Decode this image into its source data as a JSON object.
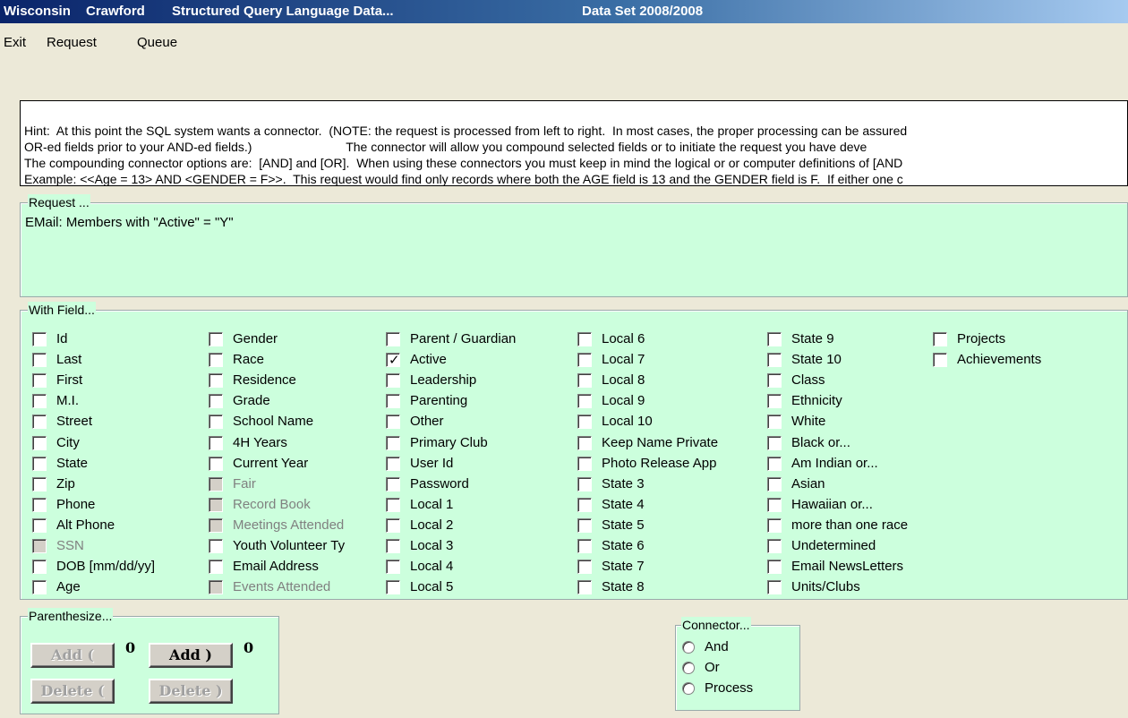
{
  "titlebar": {
    "app": "Wisconsin",
    "county": "Crawford",
    "title": "Structured Query Language Data...",
    "dataset": "Data Set 2008/2008"
  },
  "menu": {
    "exit": "Exit",
    "request": "Request",
    "queue": "Queue"
  },
  "hint": {
    "lines": [
      "Hint:  At this point the SQL system wants a connector.  (NOTE: the request is processed from left to right.  In most cases, the proper processing can be assured",
      "OR-ed fields prior to your AND-ed fields.)                           The connector will allow you compound selected fields or to initiate the request you have deve",
      "The compounding connector options are:  [AND] and [OR].  When using these connectors you must keep in mind the logical or or computer definitions of [AND",
      "Example: <<Age = 13> AND <GENDER = F>>.  This request would find only records where both the AGE field is 13 and the GENDER field is F.  If either one c"
    ]
  },
  "request": {
    "legend": "Request ...",
    "text": "EMail: Members with \"Active\" = \"Y\""
  },
  "fields": {
    "legend": "With Field...",
    "columns": [
      [
        {
          "label": "Id",
          "checked": false,
          "disabled": false
        },
        {
          "label": "Last",
          "checked": false,
          "disabled": false
        },
        {
          "label": "First",
          "checked": false,
          "disabled": false
        },
        {
          "label": "M.I.",
          "checked": false,
          "disabled": false
        },
        {
          "label": "Street",
          "checked": false,
          "disabled": false
        },
        {
          "label": "City",
          "checked": false,
          "disabled": false
        },
        {
          "label": "State",
          "checked": false,
          "disabled": false
        },
        {
          "label": "Zip",
          "checked": false,
          "disabled": false
        },
        {
          "label": "Phone",
          "checked": false,
          "disabled": false
        },
        {
          "label": "Alt Phone",
          "checked": false,
          "disabled": false
        },
        {
          "label": "SSN",
          "checked": false,
          "disabled": true
        },
        {
          "label": "DOB [mm/dd/yy]",
          "checked": false,
          "disabled": false
        },
        {
          "label": "Age",
          "checked": false,
          "disabled": false
        }
      ],
      [
        {
          "label": "Gender",
          "checked": false,
          "disabled": false
        },
        {
          "label": "Race",
          "checked": false,
          "disabled": false
        },
        {
          "label": "Residence",
          "checked": false,
          "disabled": false
        },
        {
          "label": "Grade",
          "checked": false,
          "disabled": false
        },
        {
          "label": "School Name",
          "checked": false,
          "disabled": false
        },
        {
          "label": "4H Years",
          "checked": false,
          "disabled": false
        },
        {
          "label": "Current Year",
          "checked": false,
          "disabled": false
        },
        {
          "label": "Fair",
          "checked": false,
          "disabled": true
        },
        {
          "label": "Record Book",
          "checked": false,
          "disabled": true
        },
        {
          "label": "Meetings Attended",
          "checked": false,
          "disabled": true
        },
        {
          "label": "Youth Volunteer Ty",
          "checked": false,
          "disabled": false
        },
        {
          "label": "Email Address",
          "checked": false,
          "disabled": false
        },
        {
          "label": "Events Attended",
          "checked": false,
          "disabled": true
        }
      ],
      [
        {
          "label": "Parent / Guardian",
          "checked": false,
          "disabled": false
        },
        {
          "label": "Active",
          "checked": true,
          "disabled": false
        },
        {
          "label": "Leadership",
          "checked": false,
          "disabled": false
        },
        {
          "label": "Parenting",
          "checked": false,
          "disabled": false
        },
        {
          "label": "Other",
          "checked": false,
          "disabled": false
        },
        {
          "label": "Primary Club",
          "checked": false,
          "disabled": false
        },
        {
          "label": "User Id",
          "checked": false,
          "disabled": false
        },
        {
          "label": "Password",
          "checked": false,
          "disabled": false
        },
        {
          "label": "Local 1",
          "checked": false,
          "disabled": false
        },
        {
          "label": "Local 2",
          "checked": false,
          "disabled": false
        },
        {
          "label": "Local 3",
          "checked": false,
          "disabled": false
        },
        {
          "label": "Local 4",
          "checked": false,
          "disabled": false
        },
        {
          "label": "Local 5",
          "checked": false,
          "disabled": false
        }
      ],
      [
        {
          "label": "Local 6",
          "checked": false,
          "disabled": false
        },
        {
          "label": "Local 7",
          "checked": false,
          "disabled": false
        },
        {
          "label": "Local 8",
          "checked": false,
          "disabled": false
        },
        {
          "label": "Local 9",
          "checked": false,
          "disabled": false
        },
        {
          "label": "Local 10",
          "checked": false,
          "disabled": false
        },
        {
          "label": "Keep Name Private",
          "checked": false,
          "disabled": false
        },
        {
          "label": "Photo Release App",
          "checked": false,
          "disabled": false
        },
        {
          "label": "State 3",
          "checked": false,
          "disabled": false
        },
        {
          "label": "State 4",
          "checked": false,
          "disabled": false
        },
        {
          "label": "State 5",
          "checked": false,
          "disabled": false
        },
        {
          "label": "State 6",
          "checked": false,
          "disabled": false
        },
        {
          "label": "State 7",
          "checked": false,
          "disabled": false
        },
        {
          "label": "State 8",
          "checked": false,
          "disabled": false
        }
      ],
      [
        {
          "label": "State 9",
          "checked": false,
          "disabled": false
        },
        {
          "label": "State 10",
          "checked": false,
          "disabled": false
        },
        {
          "label": "Class",
          "checked": false,
          "disabled": false
        },
        {
          "label": "Ethnicity",
          "checked": false,
          "disabled": false
        },
        {
          "label": "White",
          "checked": false,
          "disabled": false
        },
        {
          "label": "Black or...",
          "checked": false,
          "disabled": false
        },
        {
          "label": "Am Indian or...",
          "checked": false,
          "disabled": false
        },
        {
          "label": "Asian",
          "checked": false,
          "disabled": false
        },
        {
          "label": "Hawaiian or...",
          "checked": false,
          "disabled": false
        },
        {
          "label": "more than one race",
          "checked": false,
          "disabled": false
        },
        {
          "label": "Undetermined",
          "checked": false,
          "disabled": false
        },
        {
          "label": "Email NewsLetters",
          "checked": false,
          "disabled": false
        },
        {
          "label": "Units/Clubs",
          "checked": false,
          "disabled": false
        }
      ],
      [
        {
          "label": "Projects",
          "checked": false,
          "disabled": false
        },
        {
          "label": "Achievements",
          "checked": false,
          "disabled": false
        }
      ]
    ]
  },
  "parenthesize": {
    "legend": "Parenthesize...",
    "add_open": "Add  (",
    "add_close": "Add  )",
    "delete_open": "Delete  (",
    "delete_close": "Delete  )",
    "open_count": "0",
    "close_count": "0"
  },
  "connector": {
    "legend": "Connector...",
    "options": [
      "And",
      "Or",
      "Process"
    ]
  }
}
